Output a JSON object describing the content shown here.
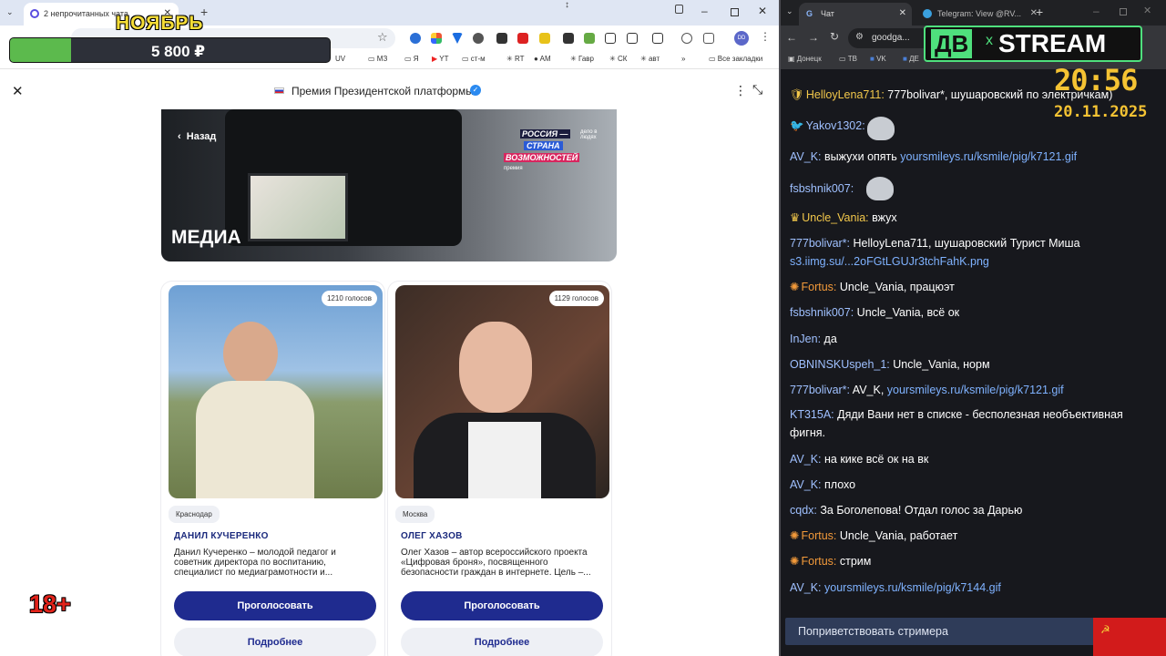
{
  "left_browser": {
    "tab_title": "2 непрочитанных чата",
    "bookmarks": [
      "UV",
      "МЗ",
      "Я",
      "YT",
      "ст-м",
      "RT",
      "AM",
      "Гавр",
      "СК",
      "авт"
    ],
    "all_bookmarks": "Все закладки",
    "profile_initials": "DD"
  },
  "overlay": {
    "month": "НОЯБРЬ",
    "donation_amount": "5 800 ₽",
    "progress_fraction": 0.19,
    "age_rating": "18+"
  },
  "modal": {
    "title": "Премия Президентской платформы",
    "banner_back": "Назад",
    "banner_title": "МЕДИА",
    "brand_line1": "РОССИЯ —",
    "brand_line2": "СТРАНА",
    "brand_line3": "ВОЗМОЖНОСТЕЙ",
    "brand_side": "дело в людях",
    "brand_sub": "премия"
  },
  "candidates": [
    {
      "votes": "1210 голосов",
      "city": "Краснодар",
      "name": "ДАНИЛ КУЧЕРЕНКО",
      "description": "Данил Кучеренко – молодой педагог и советник директора по воспитанию, специалист по медиаграмотности и...",
      "vote_label": "Проголосовать",
      "more_label": "Подробнее"
    },
    {
      "votes": "1129 голосов",
      "city": "Москва",
      "name": "ОЛЕГ ХАЗОВ",
      "description": "Олег Хазов – автор всероссийского проекта «Цифровая броня», посвященного безопасности граждан в интернете. Цель –...",
      "vote_label": "Проголосовать",
      "more_label": "Подробнее"
    }
  ],
  "right_browser": {
    "tab1": "Чат",
    "tab2": "Telegram: View @RV...",
    "url": "goodga...",
    "bookmarks": [
      "Донецк",
      "ТВ",
      "VK",
      "ДЕ"
    ]
  },
  "stream": {
    "logo_left": "ДВ",
    "logo_x": "x",
    "logo_right": "STREAM",
    "time": "20:56",
    "date": "20.11.2025"
  },
  "chat": [
    {
      "user": "HelloyLena711:",
      "text": " 777bolivar*, шушаровский по электричкам)",
      "ucolor": "#f3c84b",
      "icon": "shield"
    },
    {
      "user": "Yakov1302:",
      "text": "",
      "ucolor": "#9fc0ff",
      "icon": "bird"
    },
    {
      "user": "AV_K:",
      "text": " выжухи опять ",
      "link": "yoursmileys.ru/ksmile/pig/k7121.gif",
      "ucolor": "#9fc0ff"
    },
    {
      "user": "fsbshnik007:",
      "text": "",
      "ucolor": "#9fc0ff"
    },
    {
      "user": "Uncle_Vania:",
      "text": " вжух",
      "ucolor": "#f3c84b",
      "icon": "crown"
    },
    {
      "user": "777bolivar*:",
      "text": " HelloyLena711, шушаровский Турист Миша",
      "link2": "s3.iimg.su/...2oFGtLGUJr3tchFahK.png",
      "ucolor": "#9fc0ff"
    },
    {
      "user": "Fortus:",
      "text": " Uncle_Vania, працюэт",
      "ucolor": "#f39a3a",
      "icon": "gear"
    },
    {
      "user": "fsbshnik007:",
      "text": " Uncle_Vania, всё ок",
      "ucolor": "#9fc0ff"
    },
    {
      "user": "InJen:",
      "text": " да",
      "ucolor": "#9fc0ff"
    },
    {
      "user": "OBNINSKUspeh_1:",
      "text": " Uncle_Vania, норм",
      "ucolor": "#9fc0ff"
    },
    {
      "user": "777bolivar*:",
      "text": " AV_K, ",
      "link": "yoursmileys.ru/ksmile/pig/k7121.gif",
      "ucolor": "#9fc0ff"
    },
    {
      "user": "KT315A:",
      "text": " Дяди Вани нет в списке - бесполезная необъективная фигня.",
      "ucolor": "#9fc0ff"
    },
    {
      "user": "AV_K:",
      "text": " на кике всё ок на вк",
      "ucolor": "#9fc0ff"
    },
    {
      "user": "AV_K:",
      "text": " плохо",
      "ucolor": "#9fc0ff"
    },
    {
      "user": "cqdx:",
      "text": " За Боголепова! Отдал голос за Дарью",
      "ucolor": "#9fc0ff"
    },
    {
      "user": "Fortus:",
      "text": " Uncle_Vania, работает",
      "ucolor": "#f39a3a",
      "icon": "gear"
    },
    {
      "user": "Fortus:",
      "text": " стрим",
      "ucolor": "#f39a3a",
      "icon": "gear"
    },
    {
      "user": "AV_K:",
      "text": " ",
      "link": "yoursmileys.ru/ksmile/pig/k7144.gif",
      "ucolor": "#9fc0ff"
    }
  ],
  "greet_button": "Поприветствовать стримера"
}
